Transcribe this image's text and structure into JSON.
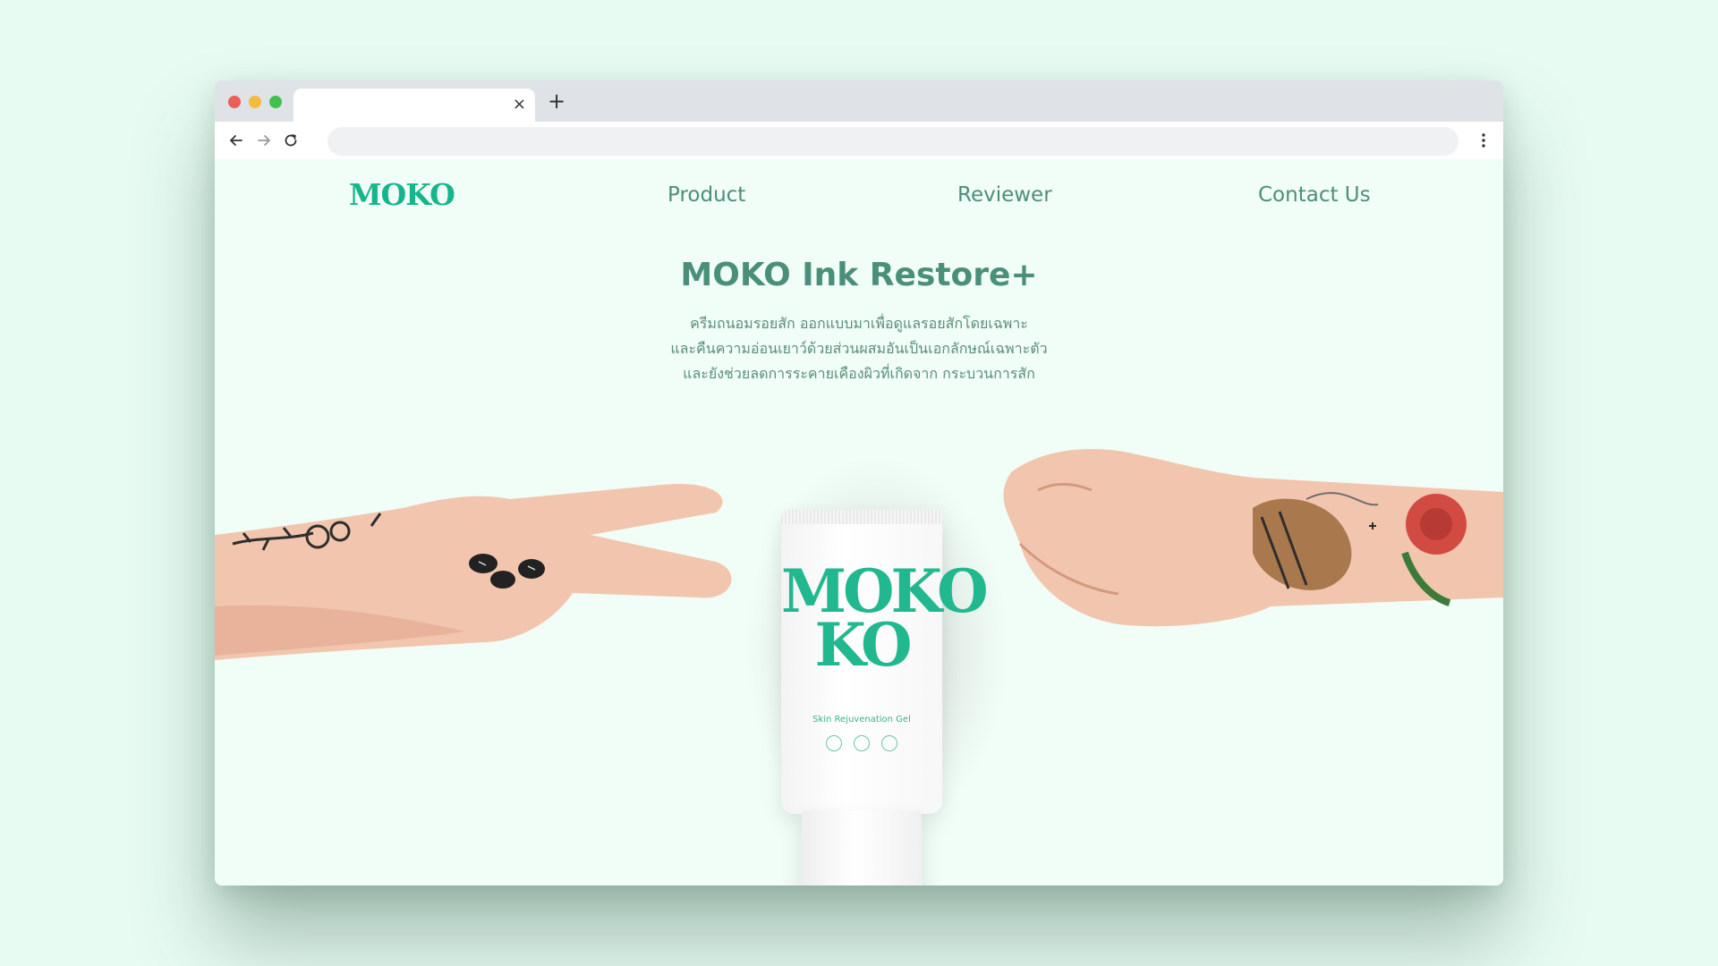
{
  "browser": {
    "tab_close_glyph": "×",
    "new_tab_glyph": "+",
    "traffic_lights": [
      "#ec5f57",
      "#f2bd3b",
      "#3fc14f"
    ],
    "icons": {
      "back": "arrow-left-icon",
      "forward": "arrow-right-icon",
      "reload": "reload-icon",
      "menu": "kebab-menu-icon"
    }
  },
  "nav": {
    "logo": "MOKO",
    "links": [
      "Product",
      "Reviewer",
      "Contact Us"
    ]
  },
  "hero": {
    "title": "MOKO Ink Restore+",
    "description": [
      "ครีมถนอมรอยสัก ออกแบบมาเพื่อดูแลรอยสักโดยเฉพาะ",
      "และคืนความอ่อนเยาว์ด้วยส่วนผสมอันเป็นเอกลักษณ์เฉพาะตัว",
      "และยังช่วยลดการระคายเคืองผิวที่เกิดจาก กระบวนการสัก"
    ]
  },
  "product": {
    "logo_line1": "MOKO",
    "logo_line2": "KO",
    "label": "Skin Rejuvenation Gel"
  },
  "colors": {
    "brand": "#16b58c",
    "text": "#4a8f7a",
    "page_bg": "#f1fdf7",
    "outer_bg": "#e7fbf2"
  }
}
